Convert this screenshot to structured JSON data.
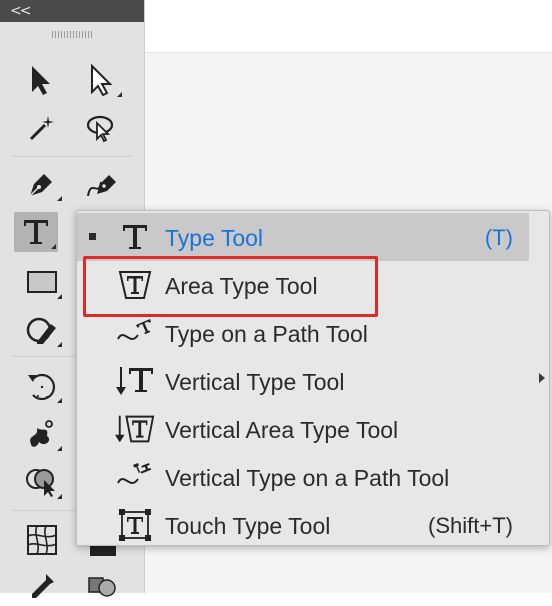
{
  "toolbar": {
    "collapse_label": "<<",
    "tools": [
      {
        "name": "selection-tool",
        "icon": "selection-arrow-icon"
      },
      {
        "name": "direct-selection-tool",
        "icon": "direct-selection-arrow-icon"
      },
      {
        "name": "magic-wand-tool",
        "icon": "magic-wand-icon"
      },
      {
        "name": "lasso-tool",
        "icon": "lasso-icon"
      },
      {
        "name": "pen-tool",
        "icon": "pen-icon"
      },
      {
        "name": "curvature-tool",
        "icon": "curvature-pen-icon"
      },
      {
        "name": "type-tool",
        "icon": "type-icon",
        "active": true
      },
      {
        "name": "line-segment-tool",
        "icon": "line-icon"
      },
      {
        "name": "rectangle-tool",
        "icon": "rectangle-icon"
      },
      {
        "name": "paintbrush-tool",
        "icon": "brush-icon"
      },
      {
        "name": "shaper-tool",
        "icon": "shaper-icon"
      },
      {
        "name": "eraser-tool",
        "icon": "eraser-icon"
      },
      {
        "name": "rotate-tool",
        "icon": "rotate-icon"
      },
      {
        "name": "scale-tool",
        "icon": "scale-icon"
      },
      {
        "name": "warp-tool",
        "icon": "warp-icon"
      },
      {
        "name": "free-transform-tool",
        "icon": "free-transform-icon"
      },
      {
        "name": "shape-builder-tool",
        "icon": "shape-builder-icon"
      },
      {
        "name": "perspective-grid-tool",
        "icon": "perspective-grid-icon"
      },
      {
        "name": "mesh-tool",
        "icon": "mesh-icon"
      },
      {
        "name": "gradient-tool",
        "icon": "gradient-icon"
      },
      {
        "name": "eyedropper-tool",
        "icon": "eyedropper-icon"
      },
      {
        "name": "blend-tool",
        "icon": "blend-icon"
      }
    ]
  },
  "flyout": {
    "items": [
      {
        "label": "Type Tool",
        "shortcut": "(T)",
        "icon": "type-icon",
        "selected": true
      },
      {
        "label": "Area Type Tool",
        "shortcut": "",
        "icon": "area-type-icon",
        "selected": false
      },
      {
        "label": "Type on a Path Tool",
        "shortcut": "",
        "icon": "type-on-path-icon",
        "selected": false
      },
      {
        "label": "Vertical Type Tool",
        "shortcut": "",
        "icon": "vertical-type-icon",
        "selected": false
      },
      {
        "label": "Vertical Area Type Tool",
        "shortcut": "",
        "icon": "vertical-area-type-icon",
        "selected": false
      },
      {
        "label": "Vertical Type on a Path Tool",
        "shortcut": "",
        "icon": "vertical-type-on-path-icon",
        "selected": false
      },
      {
        "label": "Touch Type Tool",
        "shortcut": "(Shift+T)",
        "icon": "touch-type-icon",
        "selected": false
      }
    ]
  },
  "colors": {
    "selected_text": "#1a73d9",
    "highlight_box": "#e02a2a",
    "toolbar_bg": "#e2e2e2",
    "toolbar_header": "#4a4a4a",
    "menu_bg": "#e7e7e7"
  }
}
